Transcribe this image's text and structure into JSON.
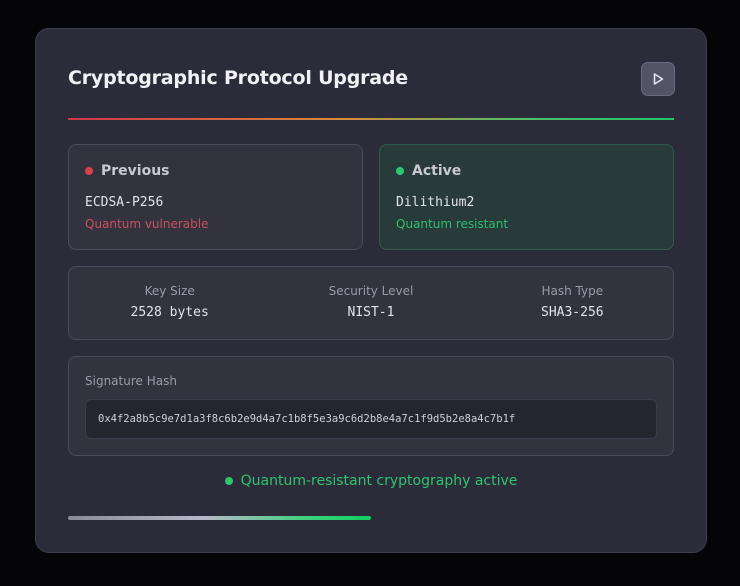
{
  "header": {
    "title": "Cryptographic Protocol Upgrade",
    "play_icon": "play-icon"
  },
  "previous": {
    "label": "Previous",
    "algorithm": "ECDSA-P256",
    "note": "Quantum vulnerable",
    "color": "#d7424f"
  },
  "active": {
    "label": "Active",
    "algorithm": "Dilithium2",
    "note": "Quantum resistant",
    "color": "#2fc46e"
  },
  "metrics": [
    {
      "label": "Key Size",
      "value": "2528 bytes"
    },
    {
      "label": "Security Level",
      "value": "NIST-1"
    },
    {
      "label": "Hash Type",
      "value": "SHA3-256"
    }
  ],
  "signature": {
    "label": "Signature Hash",
    "value": "0x4f2a8b5c9e7d1a3f8c6b2e9d4a7c1b8f5e3a9c6d2b8e4a7c1f9d5b2e8a4c7b1f"
  },
  "status": {
    "text": "Quantum-resistant cryptography active",
    "color": "#2fc46e"
  },
  "progress": {
    "fraction": 0.5
  }
}
